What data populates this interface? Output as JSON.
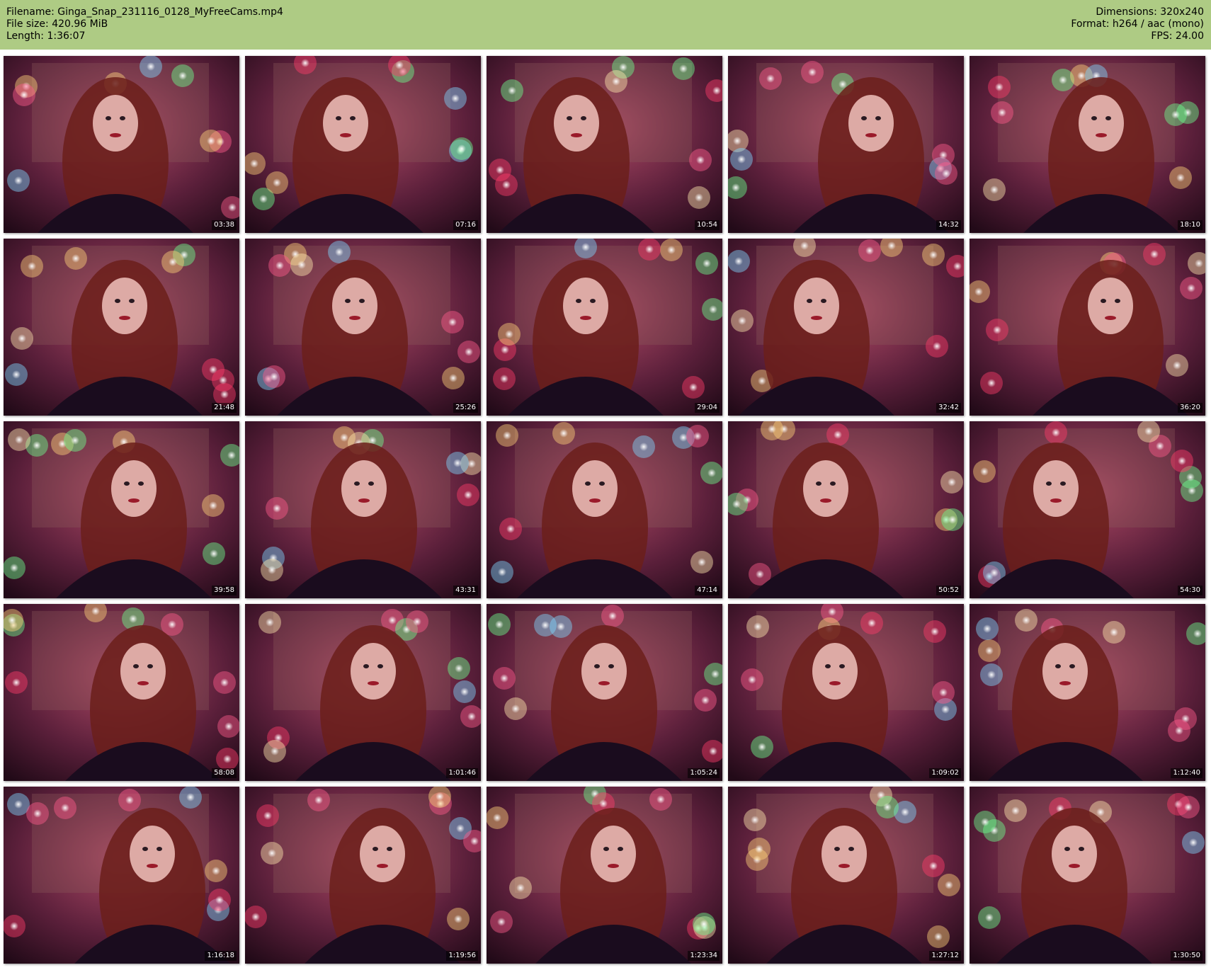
{
  "header": {
    "filename": "Filename: Ginga_Snap_231116_0128_MyFreeCams.mp4",
    "filesize": "File size: 420.96 MiB",
    "length": "Length: 1:36:07",
    "dimensions": "Dimensions: 320x240",
    "format": "Format: h264 / aac (mono)",
    "fps": "FPS: 24.00"
  },
  "colors": {
    "header_bg": "#aecb84",
    "thumb_bg": "#2a1020",
    "light_colors": [
      "#ff5a8c",
      "#ffd27a",
      "#6dff8e",
      "#7fd8ff",
      "#ff3b6b",
      "#ffe9b0"
    ]
  },
  "thumbnails": [
    {
      "time": "03:38",
      "scene": "webcam-frame"
    },
    {
      "time": "07:16",
      "scene": "webcam-frame"
    },
    {
      "time": "10:54",
      "scene": "webcam-frame"
    },
    {
      "time": "14:32",
      "scene": "webcam-frame"
    },
    {
      "time": "18:10",
      "scene": "webcam-frame"
    },
    {
      "time": "21:48",
      "scene": "webcam-frame"
    },
    {
      "time": "25:26",
      "scene": "webcam-frame"
    },
    {
      "time": "29:04",
      "scene": "webcam-frame"
    },
    {
      "time": "32:42",
      "scene": "webcam-frame"
    },
    {
      "time": "36:20",
      "scene": "webcam-frame"
    },
    {
      "time": "39:58",
      "scene": "webcam-frame"
    },
    {
      "time": "43:31",
      "scene": "webcam-frame"
    },
    {
      "time": "47:14",
      "scene": "webcam-frame"
    },
    {
      "time": "50:52",
      "scene": "webcam-frame"
    },
    {
      "time": "54:30",
      "scene": "webcam-frame"
    },
    {
      "time": "58:08",
      "scene": "webcam-frame"
    },
    {
      "time": "1:01:46",
      "scene": "webcam-frame"
    },
    {
      "time": "1:05:24",
      "scene": "webcam-frame"
    },
    {
      "time": "1:09:02",
      "scene": "webcam-frame"
    },
    {
      "time": "1:12:40",
      "scene": "webcam-frame"
    },
    {
      "time": "1:16:18",
      "scene": "webcam-frame"
    },
    {
      "time": "1:19:56",
      "scene": "webcam-frame"
    },
    {
      "time": "1:23:34",
      "scene": "webcam-frame"
    },
    {
      "time": "1:27:12",
      "scene": "webcam-frame"
    },
    {
      "time": "1:30:50",
      "scene": "webcam-frame"
    }
  ]
}
